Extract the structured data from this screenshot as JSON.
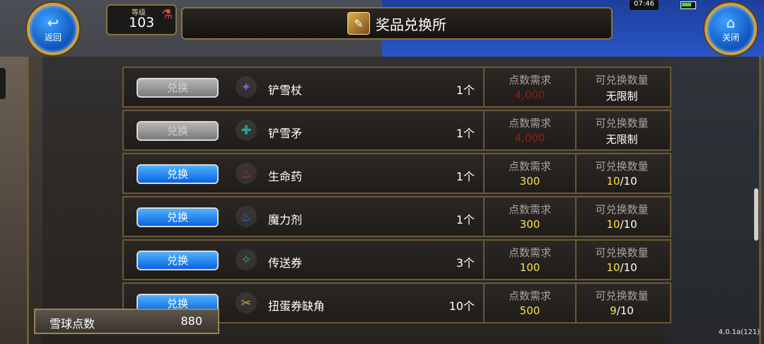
{
  "header": {
    "back_label": "返回",
    "close_label": "关闭",
    "level_caption": "等级",
    "level_value": "103",
    "title": "奖品兑换所",
    "clock": "07:46"
  },
  "points": {
    "label": "雪球点数",
    "value": "880"
  },
  "version": "4.0.1a(121)",
  "colors": {
    "button_active": "#1a7cf0",
    "button_inactive": "#9a9a9a",
    "required_insufficient": "#9a1b14",
    "required_ok": "#ffe04a"
  },
  "rows": [
    {
      "button": "兑换",
      "enabled": false,
      "icon": "staff-icon",
      "name": "铲雪杖",
      "qty": "1个",
      "points_caption": "点数需求",
      "points": "4,000",
      "limit_caption": "可兑换数量",
      "limit": "无限制",
      "limit_current": "",
      "limit_total": ""
    },
    {
      "button": "兑换",
      "enabled": false,
      "icon": "spear-icon",
      "name": "铲雪矛",
      "qty": "1个",
      "points_caption": "点数需求",
      "points": "4,000",
      "limit_caption": "可兑换数量",
      "limit": "无限制",
      "limit_current": "",
      "limit_total": ""
    },
    {
      "button": "兑换",
      "enabled": true,
      "icon": "health-potion-icon",
      "name": "生命药",
      "qty": "1个",
      "points_caption": "点数需求",
      "points": "300",
      "limit_caption": "可兑换数量",
      "limit": "",
      "limit_current": "10",
      "limit_total": "/10"
    },
    {
      "button": "兑换",
      "enabled": true,
      "icon": "mana-potion-icon",
      "name": "魔力剂",
      "qty": "1个",
      "points_caption": "点数需求",
      "points": "300",
      "limit_caption": "可兑换数量",
      "limit": "",
      "limit_current": "10",
      "limit_total": "/10"
    },
    {
      "button": "兑换",
      "enabled": true,
      "icon": "teleport-scroll-icon",
      "name": "传送券",
      "qty": "3个",
      "points_caption": "点数需求",
      "points": "100",
      "limit_caption": "可兑换数量",
      "limit": "",
      "limit_current": "10",
      "limit_total": "/10"
    },
    {
      "button": "兑换",
      "enabled": true,
      "icon": "gacha-ticket-fragment-icon",
      "name": "扭蛋券缺角",
      "qty": "10个",
      "points_caption": "点数需求",
      "points": "500",
      "limit_caption": "可兑换数量",
      "limit": "",
      "limit_current": "9",
      "limit_total": "/10"
    }
  ]
}
